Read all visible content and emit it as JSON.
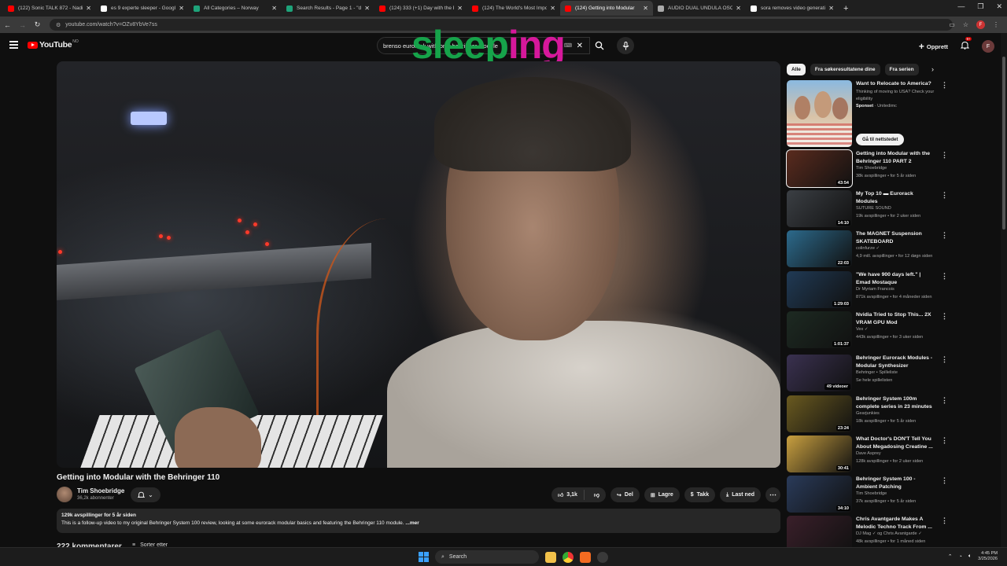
{
  "browser": {
    "tabs": [
      {
        "label": "(122) Sonic TALK 872 - Nadia St",
        "fav": "#ff0000"
      },
      {
        "label": "es 9 experte sleeper - Google S",
        "fav": "#ffffff"
      },
      {
        "label": "All Categories – Norway",
        "fav": "#1ea37a"
      },
      {
        "label": "Search Results - Page 1 - \"dual",
        "fav": "#1ea37a"
      },
      {
        "label": "(124) 333 (+1) Day with the EV",
        "fav": "#ff0000"
      },
      {
        "label": "(124) The World's Most Importa",
        "fav": "#ff0000"
      },
      {
        "label": "(124) Getting into Modular",
        "fav": "#ff0000"
      },
      {
        "label": "AUDIO DUAL UNDULA OSCILL",
        "fav": "#aaaaaa"
      },
      {
        "label": "sora removes video generating",
        "fav": "#ffffff"
      }
    ],
    "url": "youtube.com/watch?v=OZv8YbVe7ss",
    "profile_initial": "F"
  },
  "masthead": {
    "logo_text": "YouTube",
    "country": "NO",
    "search_value": "brenso eurorack with only behringer  module",
    "overlay_word_green": "sleep",
    "overlay_word_pink": "ing",
    "create_label": "Opprett",
    "notif_badge": "9+",
    "user_initial": "F"
  },
  "video": {
    "title": "Getting into Modular with the Behringer 110",
    "channel": "Tim Shoebridge",
    "subscribers": "36,2k abonnenter",
    "likes": "3,1k",
    "share_label": "Del",
    "save_label": "Lagre",
    "thanks_label": "Takk",
    "download_label": "Last ned",
    "stats": "129k avspillinger  for 5 år siden",
    "description": "This is a follow-up video to my original Behringer System 100 review, looking at some eurorack modular basics and featuring the Behringer 110 module.",
    "more_label": "...mer",
    "comments_label": "222 kommentarer",
    "sort_label": "Sorter etter"
  },
  "chips": [
    {
      "label": "Alle"
    },
    {
      "label": "Fra søkeresultatene dine"
    },
    {
      "label": "Fra serien"
    }
  ],
  "ad": {
    "title": "Want to Relocate to America?",
    "text": "Thinking of moving to USA? Check your eligibility",
    "sponsor": "Sponset",
    "advertiser": "Unitedimc",
    "cta": "Gå til nettstedet"
  },
  "recommendations": [
    {
      "title": "Getting into Modular with the Behringer 110   PART 2",
      "channel": "Tim Shoebridge",
      "meta": "38k avspillinger • for 5 år siden",
      "duration": "43:54",
      "color": "#5a2b1e"
    },
    {
      "title": "My Top 10 ▬ Eurorack Modules",
      "channel": "SUTURE SOUND",
      "meta": "19k avspillinger • for 2 uker siden",
      "duration": "14:10",
      "color": "#3b3f44"
    },
    {
      "title": "The MAGNET Suspension SKATEBOARD",
      "channel": "colinfurze ✓",
      "meta": "4,9 mill. avspillinger • for 12 døgn siden",
      "duration": "22:03",
      "color": "#2c6a8c"
    },
    {
      "title": "\"We have 900 days left.\" | Emad Mostaque",
      "channel": "Dr Myriam Francois",
      "meta": "871k avspillinger • for 4 måneder siden",
      "duration": "1:29:03",
      "color": "#203a55"
    },
    {
      "title": "Nvidia Tried to Stop This... 2X VRAM GPU Mod",
      "channel": "Vex ✓",
      "meta": "443k avspillinger • for 3 uker siden",
      "duration": "1:01:37",
      "color": "#1d2a22"
    },
    {
      "title": "Behringer Eurorack Modules - Modular Synthesizer",
      "channel": "Behringer • Spilleliste",
      "meta": "Se hele spillelisten",
      "duration": "49 videoer",
      "color": "#3a3150"
    },
    {
      "title": "Behringer System 100m complete series in 23 minutes",
      "channel": "Gearjunkies",
      "meta": "18k avspillinger • for 5 år siden",
      "duration": "23:24",
      "color": "#6a5a20"
    },
    {
      "title": "What Doctor's DON'T Tell You About Megadosing Creatine ...",
      "channel": "Dave Asprey",
      "meta": "128k avspillinger • for 2 uker siden",
      "duration": "30:41",
      "color": "#c9a040"
    },
    {
      "title": "Behringer System 100 - Ambient Patching",
      "channel": "Tim Shoebridge",
      "meta": "37k avspillinger • for 5 år siden",
      "duration": "34:10",
      "color": "#2a3b5a"
    },
    {
      "title": "Chris Avantgarde Makes A Melodic Techno Track From ...",
      "channel": "DJ Mag ✓ og Chris Avantgarde ✓",
      "meta": "48k avspillinger • for 1 måned siden",
      "duration": "",
      "color": "#3a1f2a"
    }
  ],
  "taskbar": {
    "search_label": "Search",
    "time": "4:45 PM",
    "date": "3/25/2026"
  }
}
